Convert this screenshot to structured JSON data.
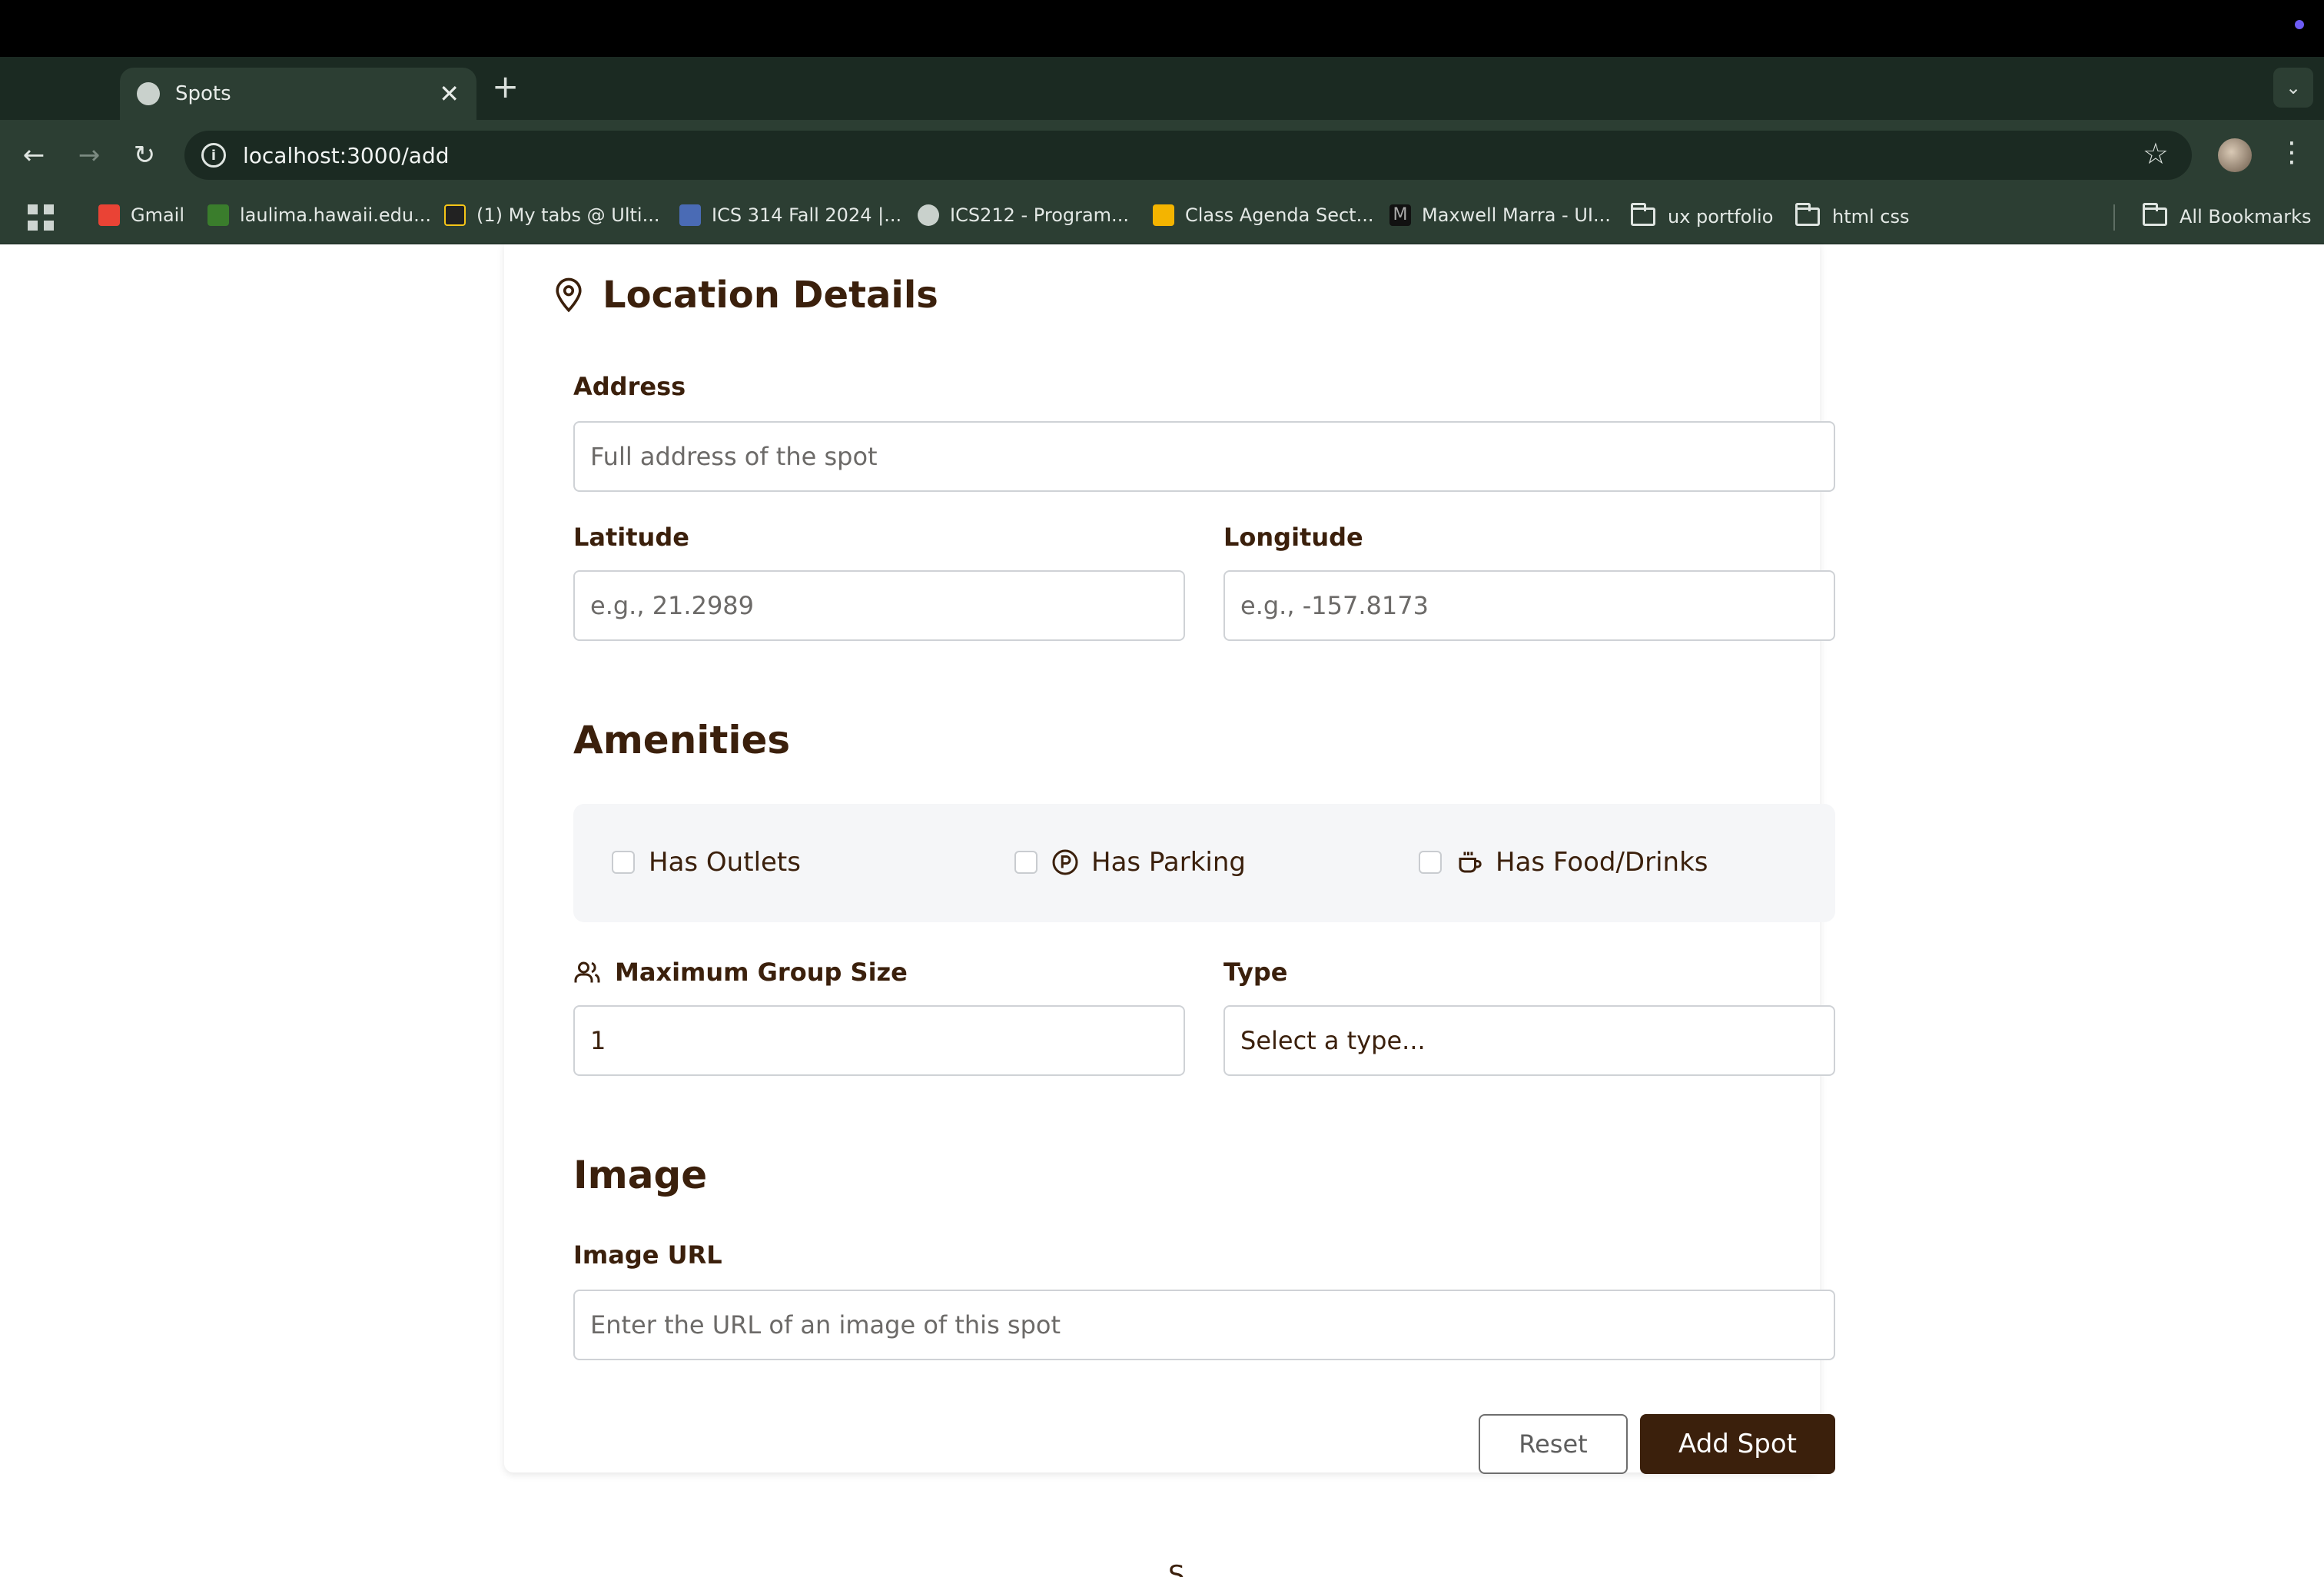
{
  "browser": {
    "tab_title": "Spots",
    "url": "localhost:3000/add",
    "bookmarks": [
      {
        "label": "Gmail",
        "icon": "gmail-icon",
        "color": "#ea4335"
      },
      {
        "label": "laulima.hawaii.edu...",
        "icon": "laulima-icon",
        "color": "#3a7d2c"
      },
      {
        "label": "(1) My tabs @ Ulti...",
        "icon": "ultimate-guitar-icon",
        "color": "#f5c518"
      },
      {
        "label": "ICS 314 Fall 2024 |...",
        "icon": "ics314-icon",
        "color": "#4a6bb5"
      },
      {
        "label": "ICS212 - Program...",
        "icon": "globe-icon",
        "color": "#c9d1cc"
      },
      {
        "label": "Class Agenda Sect...",
        "icon": "slides-icon",
        "color": "#f4b400"
      },
      {
        "label": "Maxwell Marra - UI...",
        "icon": "maxwell-marra-icon",
        "color": "#111111"
      },
      {
        "label": "ux portfolio",
        "icon": "folder-icon"
      },
      {
        "label": "html css",
        "icon": "folder-icon"
      }
    ],
    "all_bookmarks": "All Bookmarks"
  },
  "form": {
    "location": {
      "title": "Location Details",
      "address_label": "Address",
      "address_placeholder": "Full address of the spot",
      "latitude_label": "Latitude",
      "latitude_placeholder": "e.g., 21.2989",
      "longitude_label": "Longitude",
      "longitude_placeholder": "e.g., -157.8173"
    },
    "amenities": {
      "title": "Amenities",
      "outlets": "Has Outlets",
      "parking": "Has Parking",
      "food": "Has Food/Drinks",
      "max_group_label": "Maximum Group Size",
      "max_group_value": "1",
      "type_label": "Type",
      "type_value": "Select a type..."
    },
    "image": {
      "title": "Image",
      "url_label": "Image URL",
      "url_placeholder": "Enter the URL of an image of this spot"
    },
    "reset_label": "Reset",
    "submit_label": "Add Spot"
  },
  "footer_peek": "S",
  "colors": {
    "brand_brown": "#3b200c",
    "chrome_dark": "#1b2a22",
    "chrome_mid": "#2c3e33",
    "amenities_bg": "#f5f6f8"
  }
}
